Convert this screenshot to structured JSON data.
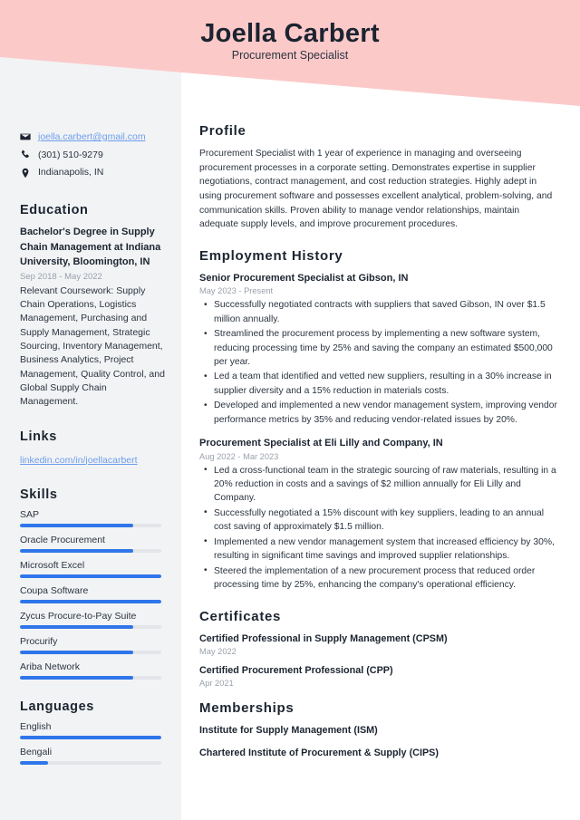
{
  "header": {
    "name": "Joella Carbert",
    "title": "Procurement Specialist",
    "banner_color": "#fcc9c9"
  },
  "sidebar": {
    "contact": {
      "email": "joella.carbert@gmail.com",
      "phone": "(301) 510-9279",
      "location": "Indianapolis, IN"
    },
    "education": {
      "heading": "Education",
      "degree": "Bachelor's Degree in Supply Chain Management at Indiana University, Bloomington, IN",
      "date": "Sep 2018 - May 2022",
      "description": "Relevant Coursework: Supply Chain Operations, Logistics Management, Purchasing and Supply Management, Strategic Sourcing, Inventory Management, Business Analytics, Project Management, Quality Control, and Global Supply Chain Management."
    },
    "links": {
      "heading": "Links",
      "items": [
        {
          "label": "linkedin.com/in/joellacarbert"
        }
      ]
    },
    "skills": {
      "heading": "Skills",
      "items": [
        {
          "label": "SAP",
          "level": 80
        },
        {
          "label": "Oracle Procurement",
          "level": 80
        },
        {
          "label": "Microsoft Excel",
          "level": 100
        },
        {
          "label": "Coupa Software",
          "level": 100
        },
        {
          "label": "Zycus Procure-to-Pay Suite",
          "level": 80
        },
        {
          "label": "Procurify",
          "level": 80
        },
        {
          "label": "Ariba Network",
          "level": 80
        }
      ]
    },
    "languages": {
      "heading": "Languages",
      "items": [
        {
          "label": "English",
          "level": 100
        },
        {
          "label": "Bengali",
          "level": 20
        }
      ]
    },
    "accent_color": "#2f76ea",
    "link_color": "#6d9eeb"
  },
  "main": {
    "profile": {
      "heading": "Profile",
      "text": "Procurement Specialist with 1 year of experience in managing and overseeing procurement processes in a corporate setting. Demonstrates expertise in supplier negotiations, contract management, and cost reduction strategies. Highly adept in using procurement software and possesses excellent analytical, problem-solving, and communication skills. Proven ability to manage vendor relationships, maintain adequate supply levels, and improve procurement procedures."
    },
    "employment": {
      "heading": "Employment History",
      "jobs": [
        {
          "title": "Senior Procurement Specialist at Gibson, IN",
          "date": "May 2023 - Present",
          "bullets": [
            "Successfully negotiated contracts with suppliers that saved Gibson, IN over $1.5 million annually.",
            "Streamlined the procurement process by implementing a new software system, reducing processing time by 25% and saving the company an estimated $500,000 per year.",
            "Led a team that identified and vetted new suppliers, resulting in a 30% increase in supplier diversity and a 15% reduction in materials costs.",
            "Developed and implemented a new vendor management system, improving vendor performance metrics by 35% and reducing vendor-related issues by 20%."
          ]
        },
        {
          "title": "Procurement Specialist at Eli Lilly and Company, IN",
          "date": "Aug 2022 - Mar 2023",
          "bullets": [
            "Led a cross-functional team in the strategic sourcing of raw materials, resulting in a 20% reduction in costs and a savings of $2 million annually for Eli Lilly and Company.",
            "Successfully negotiated a 15% discount with key suppliers, leading to an annual cost saving of approximately $1.5 million.",
            "Implemented a new vendor management system that increased efficiency by 30%, resulting in significant time savings and improved supplier relationships.",
            "Steered the implementation of a new procurement process that reduced order processing time by 25%, enhancing the company's operational efficiency."
          ]
        }
      ]
    },
    "certificates": {
      "heading": "Certificates",
      "items": [
        {
          "name": "Certified Professional in Supply Management (CPSM)",
          "date": "May 2022"
        },
        {
          "name": "Certified Procurement Professional (CPP)",
          "date": "Apr 2021"
        }
      ]
    },
    "memberships": {
      "heading": "Memberships",
      "items": [
        {
          "name": "Institute for Supply Management (ISM)"
        },
        {
          "name": "Chartered Institute of Procurement & Supply (CIPS)"
        }
      ]
    }
  }
}
